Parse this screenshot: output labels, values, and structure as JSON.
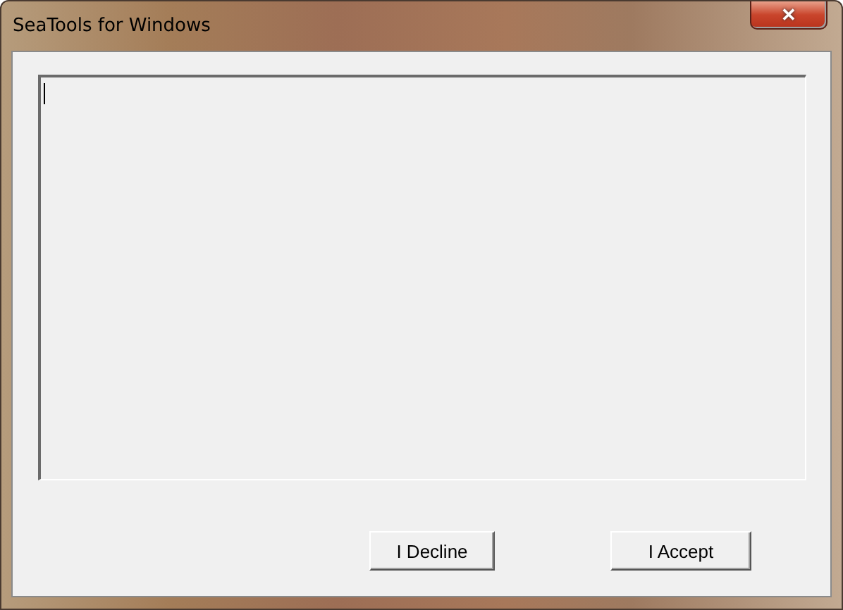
{
  "window": {
    "title": "SeaTools for Windows",
    "close_symbol": "✕"
  },
  "text_area": {
    "focused": true
  },
  "buttons": [
    {
      "label": "I Decline"
    },
    {
      "label": "I Accept"
    }
  ]
}
